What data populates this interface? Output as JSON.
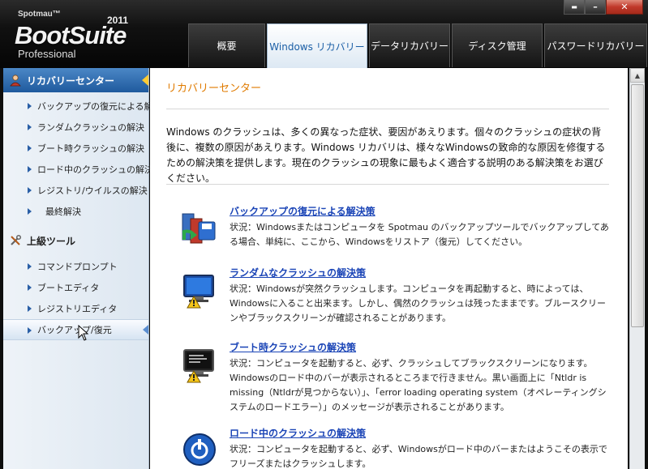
{
  "window": {
    "brand": "Spotmau™",
    "year": "2011",
    "product": "BootSuite",
    "edition": "Professional",
    "controls": {
      "menu": "▬",
      "minimize": "–",
      "close": "✕"
    }
  },
  "tabs": [
    {
      "label": "概要",
      "active": false
    },
    {
      "label": "Windows リカバリー",
      "active": true
    },
    {
      "label": "データリカバリー",
      "active": false
    },
    {
      "label": "ディスク管理",
      "active": false
    },
    {
      "label": "パスワードリカバリー",
      "active": false
    }
  ],
  "sidebar": {
    "section1": "リカバリーセンター",
    "items1": [
      "バックアップの復元による解決",
      "ランダムクラッシュの解決",
      "ブート時クラッシュの解決",
      "ロード中のクラッシュの解決",
      "レジストリ/ウイルスの解決",
      "最終解決"
    ],
    "section2": "上級ツール",
    "items2": [
      "コマンドプロンプト",
      "ブートエディタ",
      "レジストリエディタ",
      "バックアップ/復元"
    ]
  },
  "content": {
    "title": "リカバリーセンター",
    "intro": "Windows のクラッシュは、多くの異なった症状、要因があえります。個々のクラッシュの症状の背後に、複数の原因があえります。Windows リカバリは、様々なWindowsの致命的な原因を修復するための解決策を提供します。現在のクラッシュの現象に最もよく適合する説明のある解決策をお選びください。",
    "solutions": [
      {
        "title": "バックアップの復元による解決策",
        "desc": "状況：Windowsまたはコンピュータを Spotmau のバックアップツールでバックアップしてある場合、単純に、ここから、Windowsをリストア（復元）してください。",
        "icon": "backup-restore-icon"
      },
      {
        "title": "ランダムなクラッシュの解決策",
        "desc": "状況：Windowsが突然クラッシュします。コンピュータを再起動すると、時によっては、Windowsに入ること出来ます。しかし、偶然のクラッシュは残ったままです。ブルースクリーンやブラックスクリーンが確認されることがあります。",
        "icon": "random-crash-icon"
      },
      {
        "title": "ブート時クラッシュの解決策",
        "desc": "状況：コンピュータを起動すると、必ず、クラッシュしてブラックスクリーンになります。Windowsのロード中のバーが表示されるところまで行きません。黒い画面上に「Ntldr is missing（Ntldrが見つからない）」、「error loading operating system（オペレーティングシステムのロードエラー）」のメッセージが表示されることがあります。",
        "icon": "boot-crash-icon"
      },
      {
        "title": "ロード中のクラッシュの解決策",
        "desc": "状況：コンピュータを起動すると、必ず、Windowsがロード中のバーまたはようこその表示でフリーズまたはクラッシュします。",
        "icon": "power-icon"
      }
    ]
  }
}
